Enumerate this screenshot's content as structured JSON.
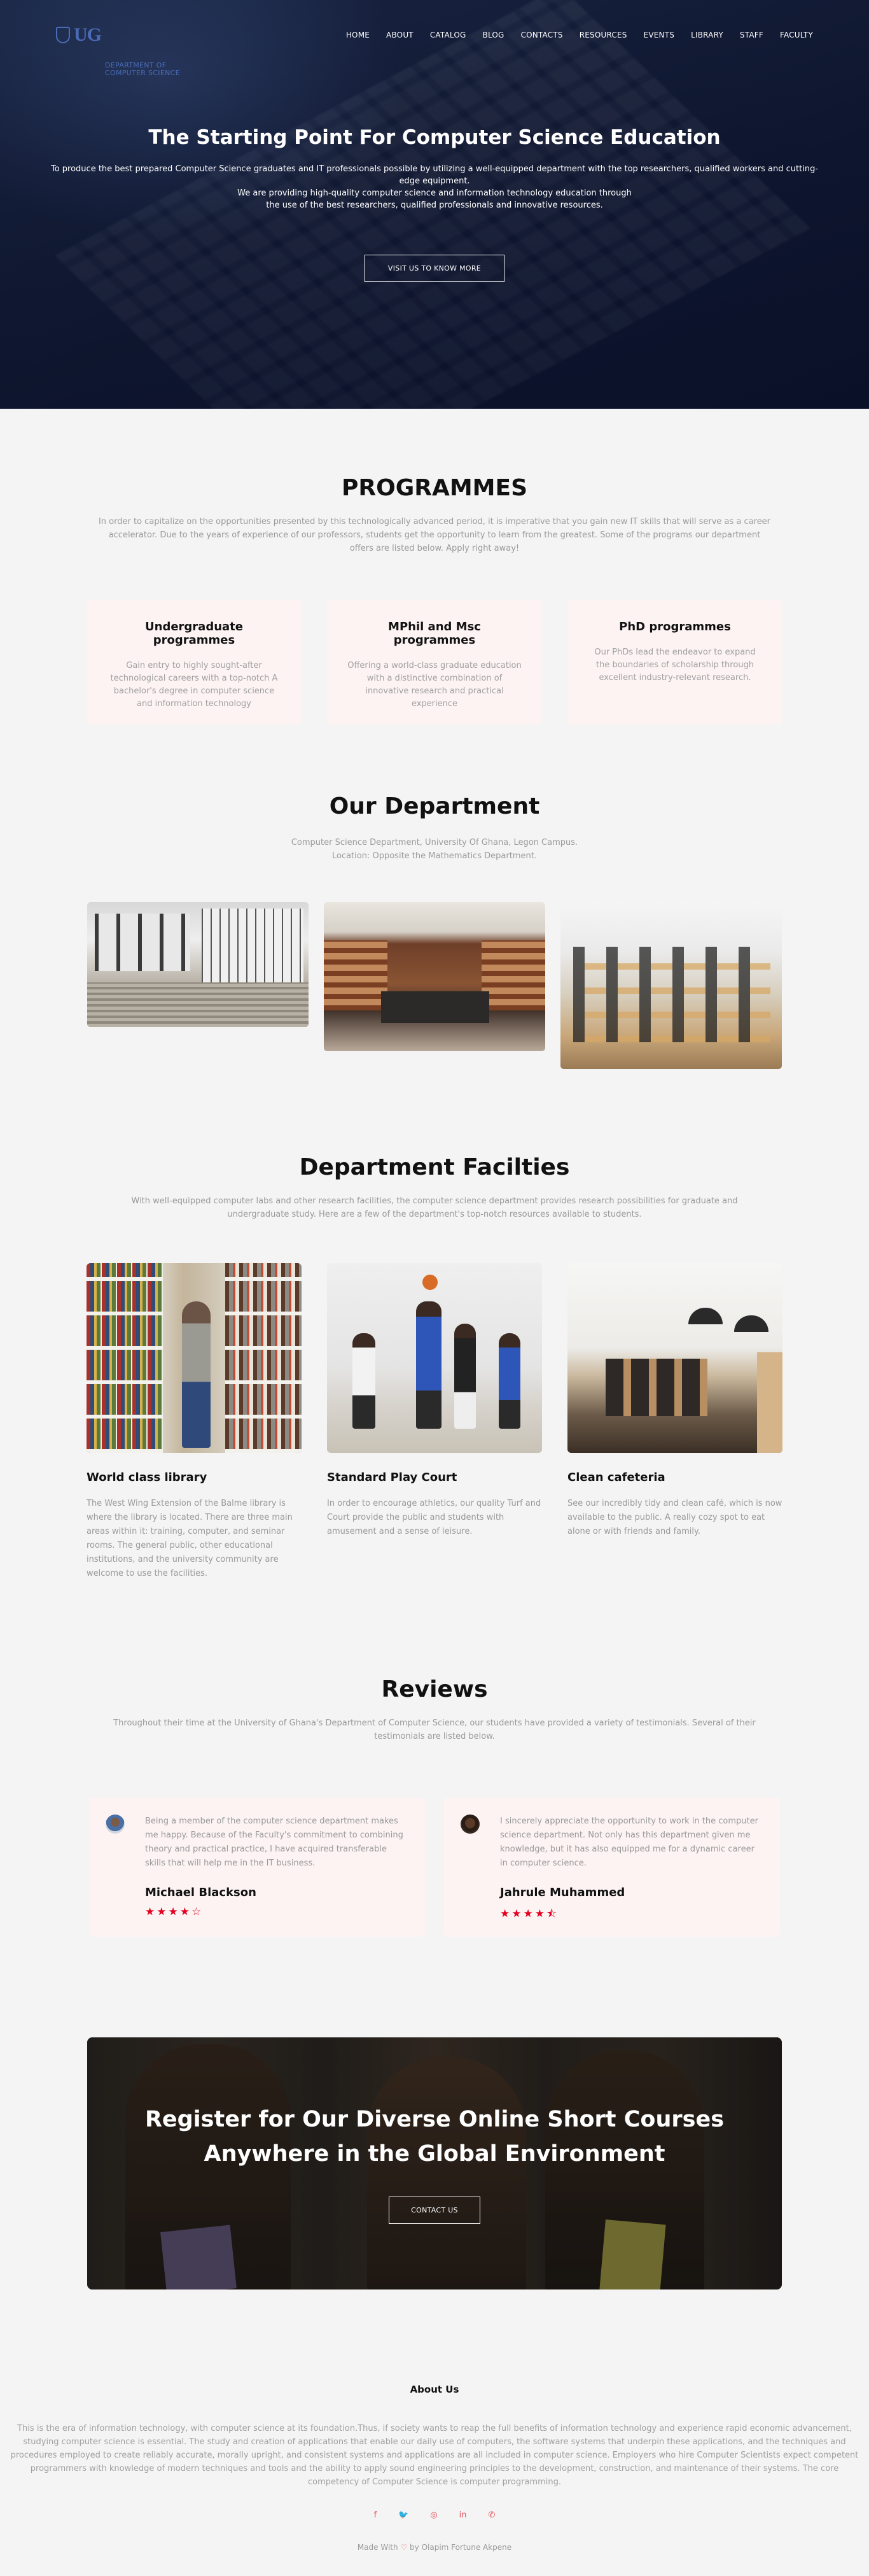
{
  "nav": {
    "logo_ug": "UG",
    "logo_line1": "DEPARTMENT OF",
    "logo_line2": "COMPUTER SCIENCE",
    "items": [
      "HOME",
      "ABOUT",
      "CATALOG",
      "BLOG",
      "CONTACTS",
      "RESOURCES",
      "EVENTS",
      "LIBRARY",
      "STAFF",
      "FACULTY"
    ]
  },
  "hero": {
    "title": "The Starting Point For Computer Science Education",
    "text1": "To produce the best prepared Computer Science graduates and IT professionals possible by utilizing a well-equipped department with the top researchers, qualified workers and cutting-edge equipment.",
    "text2": "We are providing high-quality computer science and information technology education through the use of the best researchers, qualified professionals and innovative resources.",
    "button": "VISIT US TO KNOW MORE"
  },
  "programmes": {
    "title": "PROGRAMMES",
    "lead": "In order to capitalize on the opportunities presented by this technologically advanced period, it is imperative that you gain new IT skills that will serve as a career accelerator. Due to the years of experience of our professors, students get the opportunity to learn from the greatest. Some of the programs our department offers are listed below. Apply right away!",
    "cards": [
      {
        "title": "Undergraduate programmes",
        "text": "Gain entry to highly sought-after technological careers with a top-notch A bachelor's degree in computer science and information technology"
      },
      {
        "title": "MPhil and Msc programmes",
        "text": "Offering a world-class graduate education with a distinctive combination of innovative research and practical experience"
      },
      {
        "title": "PhD programmes",
        "text": "Our PhDs lead the endeavor to expand the boundaries of scholarship through excellent industry-relevant research."
      }
    ]
  },
  "department": {
    "title": "Our Department",
    "line1": "Computer Science Department, University Of Ghana, Legon Campus.",
    "line2": "Location: Opposite the Mathematics Department."
  },
  "facilities": {
    "title": "Department Facilties",
    "lead": "With well-equipped computer labs and other research facilities, the computer science department provides research possibilities for graduate and undergraduate study. Here are a few of the department's top-notch resources available to students.",
    "items": [
      {
        "title": "World class library",
        "text": "The West Wing Extension of the Balme library is where the library is located. There are three main areas within it: training, computer, and seminar rooms. The general public, other educational institutions, and the university community are welcome to use the facilities."
      },
      {
        "title": "Standard Play Court",
        "text": "In order to encourage athletics, our quality Turf and Court provide the public and students with amusement and a sense of leisure."
      },
      {
        "title": "Clean cafeteria",
        "text": "See our incredibly tidy and clean café, which is now available to the public. A really cozy spot to eat alone or with friends and family."
      }
    ]
  },
  "reviews": {
    "title": "Reviews",
    "lead": "Throughout their time at the University of Ghana's Department of Computer Science, our students have provided a variety of testimonials. Several of their testimonials are listed below.",
    "items": [
      {
        "text": "Being a member of the computer science department makes me happy. Because of the Faculty's commitment to combining theory and practical practice, I have acquired transferable skills that will help me in the IT business.",
        "name": "Michael Blackson",
        "stars": "★★★★☆"
      },
      {
        "text": "I sincerely appreciate the opportunity to work in the computer science department. Not only has this department given me knowledge, but it has also equipped me for a dynamic career in computer science.",
        "name": "Jahrule Muhammed",
        "stars": "★★★★⯪"
      }
    ]
  },
  "cta": {
    "title": "Register for Our Diverse Online Short Courses Anywhere in the Global Environment",
    "button": "CONTACT US"
  },
  "footer": {
    "title": "About Us",
    "text": "This is the era of information technology, with computer science at its foundation.Thus, if society wants to reap the full benefits of information technology and experience rapid economic advancement, studying computer science is essential. The study and creation of applications that enable our daily use of computers, the software systems that underpin these applications, and the techniques and procedures employed to create reliably accurate, morally upright, and consistent systems and applications are all included in computer science. Employers who hire Computer Scientists expect competent programmers with knowledge of modern techniques and tools and the ability to apply sound engineering principles to the development, construction, and maintenance of their systems. The core competency of Computer Science is computer programming.",
    "made_prefix": "Made With",
    "heart": "♡",
    "made_suffix": "by Olapim Fortune Akpene"
  },
  "icons": {
    "facebook": "f",
    "twitter": "🐦",
    "instagram": "◎",
    "linkedin": "in",
    "whatsapp": "✆"
  }
}
